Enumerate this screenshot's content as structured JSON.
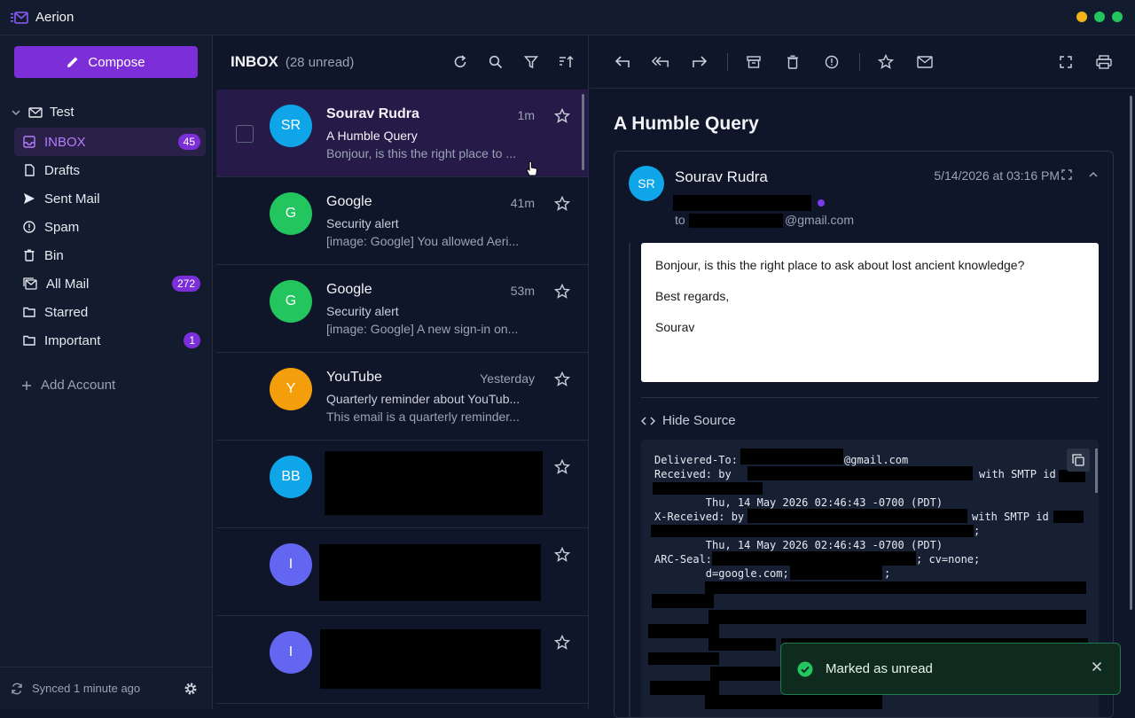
{
  "app": {
    "name": "Aerion",
    "window_controls": {
      "colors": [
        "#f5b21b",
        "#22c55e",
        "#22c55e"
      ]
    }
  },
  "sidebar": {
    "compose_label": "Compose",
    "account_name": "Test",
    "folders": [
      {
        "label": "INBOX",
        "badge": "45",
        "icon": "inbox-icon",
        "active": true
      },
      {
        "label": "Drafts",
        "icon": "file-icon"
      },
      {
        "label": "Sent Mail",
        "icon": "send-icon"
      },
      {
        "label": "Spam",
        "icon": "alert-circle-icon"
      },
      {
        "label": "Bin",
        "icon": "trash-icon"
      },
      {
        "label": "All Mail",
        "badge": "272",
        "icon": "mail-stack-icon"
      },
      {
        "label": "Starred",
        "icon": "folder-icon"
      },
      {
        "label": "Important",
        "badge": "1",
        "icon": "folder-icon"
      }
    ],
    "add_account_label": "Add Account",
    "sync_status": "Synced 1 minute ago"
  },
  "list": {
    "title": "INBOX",
    "unread": "(28 unread)",
    "messages": [
      {
        "initials": "SR",
        "avatar_color": "#0ea5e9",
        "sender": "Sourav Rudra",
        "time": "1m",
        "subject": "A Humble Query",
        "snippet": "Bonjour, is this the right place to ...",
        "selected": true,
        "unread": true
      },
      {
        "initials": "G",
        "avatar_color": "#22c55e",
        "sender": "Google",
        "time": "41m",
        "subject": "Security alert",
        "snippet": "[image: Google] You allowed Aeri..."
      },
      {
        "initials": "G",
        "avatar_color": "#22c55e",
        "sender": "Google",
        "time": "53m",
        "subject": "Security alert",
        "snippet": "[image: Google] A new sign-in on..."
      },
      {
        "initials": "Y",
        "avatar_color": "#f59e0b",
        "sender": "YouTube",
        "time": "Yesterday",
        "subject": "Quarterly reminder about YouTub...",
        "snippet": "This email is a quarterly reminder..."
      },
      {
        "initials": "BB",
        "avatar_color": "#0ea5e9",
        "redacted": true
      },
      {
        "initials": "I",
        "avatar_color": "#6366f1",
        "redacted": true
      },
      {
        "initials": "I",
        "avatar_color": "#6366f1",
        "redacted": true
      }
    ]
  },
  "reader": {
    "subject": "A Humble Query",
    "from_initials": "SR",
    "from_name": "Sourav Rudra",
    "date": "5/14/2026 at 03:16 PM",
    "to_label": "to",
    "to_domain": "@gmail.com",
    "body": [
      "Bonjour, is this the right place to ask about lost ancient knowledge?",
      "Best regards,",
      "Sourav"
    ],
    "hide_source_label": "Hide Source",
    "source_lines": [
      "Delivered-To:",
      "@gmail.com",
      "Received: by",
      "with SMTP id",
      "        Thu, 14 May 2026 02:46:43 -0700 (PDT)",
      "X-Received: by",
      "with SMTP id",
      ";",
      "        Thu, 14 May 2026 02:46:43 -0700 (PDT)",
      "ARC-Seal:",
      "; cv=none;",
      "        d=google.com;",
      ";"
    ]
  },
  "toast": {
    "message": "Marked as unread"
  }
}
